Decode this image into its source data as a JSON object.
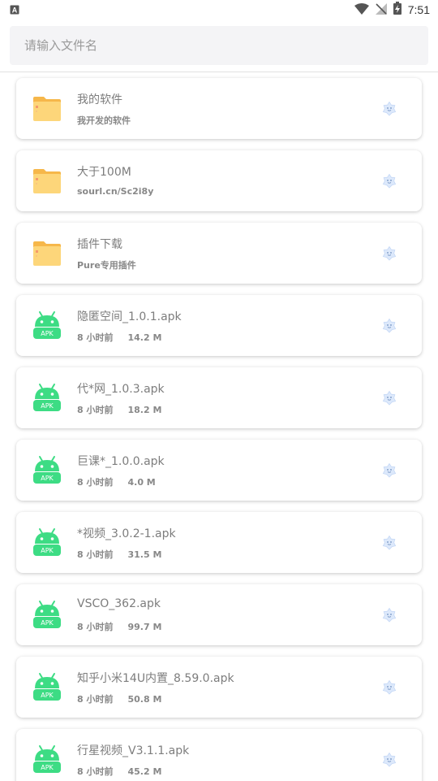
{
  "status_bar": {
    "time": "7:51",
    "icons": [
      "notification-a-icon",
      "wifi-icon",
      "no-signal-icon",
      "battery-charging-icon"
    ]
  },
  "search": {
    "placeholder": "请输入文件名",
    "value": ""
  },
  "files": [
    {
      "name": "我的软件",
      "subtitle": "我开发的软件",
      "icon": "folder-icon"
    },
    {
      "name": "大于100M",
      "subtitle": "sourl.cn/Sc2i8y",
      "icon": "folder-icon"
    },
    {
      "name": "插件下载",
      "subtitle": "Pure专用插件",
      "icon": "folder-icon"
    },
    {
      "name": "隐匿空间_1.0.1.apk",
      "time": "8 小时前",
      "size": "14.2 M",
      "icon": "apk-android-icon",
      "badge": "APK"
    },
    {
      "name": "代*网_1.0.3.apk",
      "time": "8 小时前",
      "size": "18.2 M",
      "icon": "apk-android-icon",
      "badge": "APK"
    },
    {
      "name": "巨课*_1.0.0.apk",
      "time": "8 小时前",
      "size": "4.0 M",
      "icon": "apk-android-icon",
      "badge": "APK"
    },
    {
      "name": "*视频_3.0.2-1.apk",
      "time": "8 小时前",
      "size": "31.5 M",
      "icon": "apk-android-icon",
      "badge": "APK"
    },
    {
      "name": "VSCO_362.apk",
      "time": "8 小时前",
      "size": "99.7 M",
      "icon": "apk-android-icon",
      "badge": "APK"
    },
    {
      "name": "知乎小米14U内置_8.59.0.apk",
      "time": "8 小时前",
      "size": "50.8 M",
      "icon": "apk-android-icon",
      "badge": "APK"
    },
    {
      "name": "行星视频_V3.1.1.apk",
      "time": "8 小时前",
      "size": "45.2 M",
      "icon": "apk-android-icon",
      "badge": "APK"
    }
  ],
  "colors": {
    "folder_back": "#f6b74a",
    "folder_front": "#fdd67a",
    "apk_green": "#3ddc84",
    "card_shadow": "#d0d0d0",
    "action_icon": "#cfe0fa"
  }
}
